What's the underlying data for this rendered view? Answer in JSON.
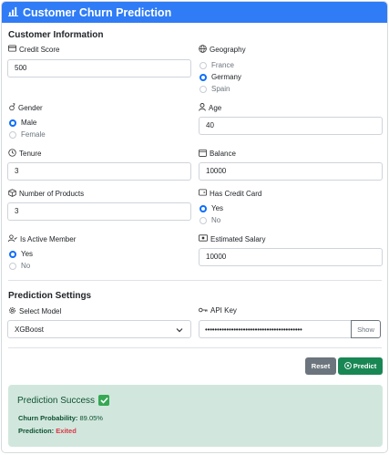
{
  "header": {
    "title": "Customer Churn Prediction",
    "icon": "bar-chart-icon"
  },
  "customer_info": {
    "section_title": "Customer Information",
    "credit_score": {
      "label": "Credit Score",
      "value": "500"
    },
    "geography": {
      "label": "Geography",
      "options": [
        "France",
        "Germany",
        "Spain"
      ],
      "selected": "Germany"
    },
    "gender": {
      "label": "Gender",
      "options": [
        "Male",
        "Female"
      ],
      "selected": "Male"
    },
    "age": {
      "label": "Age",
      "value": "40"
    },
    "tenure": {
      "label": "Tenure",
      "value": "3"
    },
    "balance": {
      "label": "Balance",
      "value": "10000"
    },
    "num_products": {
      "label": "Number of Products",
      "value": "3"
    },
    "has_credit_card": {
      "label": "Has Credit Card",
      "options": [
        "Yes",
        "No"
      ],
      "selected": "Yes"
    },
    "is_active_member": {
      "label": "Is Active Member",
      "options": [
        "Yes",
        "No"
      ],
      "selected": "Yes"
    },
    "estimated_salary": {
      "label": "Estimated Salary",
      "value": "10000"
    }
  },
  "prediction_settings": {
    "section_title": "Prediction Settings",
    "model": {
      "label": "Select Model",
      "value": "XGBoost"
    },
    "api_key": {
      "label": "API Key",
      "masked_value": "•••••••••••••••••••••••••••••••••••••••••",
      "show_label": "Show"
    }
  },
  "actions": {
    "reset_label": "Reset",
    "predict_label": "Predict"
  },
  "result": {
    "title": "Prediction Success",
    "churn_probability_label": "Churn Probability:",
    "churn_probability_value": "89.05%",
    "prediction_label": "Prediction:",
    "prediction_value": "Exited"
  },
  "colors": {
    "header": "#2f7cf6",
    "predict": "#198754",
    "reset": "#6c757d",
    "result_bg": "#d1e7dd",
    "exited": "#dc3545"
  }
}
